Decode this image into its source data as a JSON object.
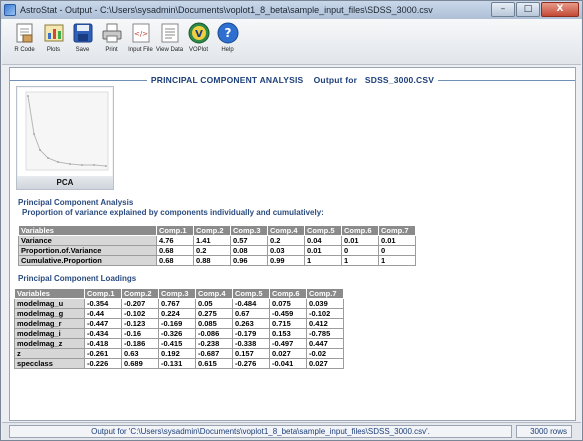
{
  "window": {
    "title": "AstroStat - Output - C:\\Users\\sysadmin\\Documents\\voplot1_8_beta\\sample_input_files\\SDSS_3000.csv",
    "controls": {
      "minimize": "–",
      "maximize": "□",
      "close": "X"
    }
  },
  "toolbar": {
    "items": [
      {
        "label": "R Code",
        "icon": "r-code-icon"
      },
      {
        "label": "Plots",
        "icon": "plots-icon"
      },
      {
        "label": "Save",
        "icon": "save-icon"
      },
      {
        "label": "Print",
        "icon": "print-icon"
      },
      {
        "label": "Input File",
        "icon": "input-file-icon"
      },
      {
        "label": "View Data",
        "icon": "view-data-icon"
      },
      {
        "label": "VOPlot",
        "icon": "voplot-icon"
      },
      {
        "label": "Help",
        "icon": "help-icon"
      }
    ]
  },
  "header": {
    "prefix": "PRINCIPAL COMPONENT ANALYSIS",
    "middle": "Output for",
    "file": "SDSS_3000.CSV"
  },
  "thumbnail": {
    "caption": "PCA"
  },
  "pca": {
    "title": "Principal Component Analysis",
    "subtitle": "Proportion of variance explained by components individually and cumulatively:",
    "columns": [
      "Variables",
      "Comp.1",
      "Comp.2",
      "Comp.3",
      "Comp.4",
      "Comp.5",
      "Comp.6",
      "Comp.7"
    ],
    "rows": [
      [
        "Variance",
        "4.76",
        "1.41",
        "0.57",
        "0.2",
        "0.04",
        "0.01",
        "0.01"
      ],
      [
        "Proportion.of.Variance",
        "0.68",
        "0.2",
        "0.08",
        "0.03",
        "0.01",
        "0",
        "0"
      ],
      [
        "Cumulative.Proportion",
        "0.68",
        "0.88",
        "0.96",
        "0.99",
        "1",
        "1",
        "1"
      ]
    ]
  },
  "loadings": {
    "title": "Principal Component Loadings",
    "columns": [
      "Variables",
      "Comp.1",
      "Comp.2",
      "Comp.3",
      "Comp.4",
      "Comp.5",
      "Comp.6",
      "Comp.7"
    ],
    "rows": [
      [
        "modelmag_u",
        "-0.354",
        "-0.207",
        "0.767",
        "0.05",
        "-0.484",
        "0.075",
        "0.039"
      ],
      [
        "modelmag_g",
        "-0.44",
        "-0.102",
        "0.224",
        "0.275",
        "0.67",
        "-0.459",
        "-0.102"
      ],
      [
        "modelmag_r",
        "-0.447",
        "-0.123",
        "-0.169",
        "0.085",
        "0.263",
        "0.715",
        "0.412"
      ],
      [
        "modelmag_i",
        "-0.434",
        "-0.16",
        "-0.326",
        "-0.086",
        "-0.179",
        "0.153",
        "-0.785"
      ],
      [
        "modelmag_z",
        "-0.418",
        "-0.186",
        "-0.415",
        "-0.238",
        "-0.338",
        "-0.497",
        "0.447"
      ],
      [
        "z",
        "-0.261",
        "0.63",
        "0.192",
        "-0.687",
        "0.157",
        "0.027",
        "-0.02"
      ],
      [
        "specclass",
        "-0.226",
        "0.689",
        "-0.131",
        "0.615",
        "-0.276",
        "-0.041",
        "0.027"
      ]
    ]
  },
  "status": {
    "output": "Output for 'C:\\Users\\sysadmin\\Documents\\voplot1_8_beta\\sample_input_files\\SDSS_3000.csv'.",
    "rows": "3000 rows"
  }
}
